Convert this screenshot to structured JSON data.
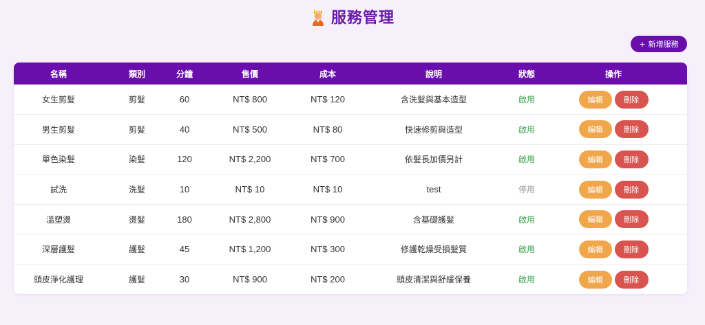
{
  "header": {
    "title": "服務管理",
    "logo_icon": "barber-person-icon"
  },
  "toolbar": {
    "add_label": "新增服務"
  },
  "colors": {
    "accent": "#6a0dad",
    "edit": "#f0a64a",
    "delete": "#d9534f",
    "active": "#3aa14a",
    "inactive": "#9a9a9a"
  },
  "table": {
    "columns": [
      "名稱",
      "類別",
      "分鐘",
      "售價",
      "成本",
      "說明",
      "狀態",
      "操作"
    ],
    "rows": [
      {
        "name": "女生剪髮",
        "category": "剪髮",
        "minutes": "60",
        "price": "NT$ 800",
        "cost": "NT$ 120",
        "desc": "含洗髮與基本造型",
        "status": "啟用",
        "active": true
      },
      {
        "name": "男生剪髮",
        "category": "剪髮",
        "minutes": "40",
        "price": "NT$ 500",
        "cost": "NT$ 80",
        "desc": "快速修剪與造型",
        "status": "啟用",
        "active": true
      },
      {
        "name": "單色染髮",
        "category": "染髮",
        "minutes": "120",
        "price": "NT$ 2,200",
        "cost": "NT$ 700",
        "desc": "依髮長加價另計",
        "status": "啟用",
        "active": true
      },
      {
        "name": "試洗",
        "category": "洗髮",
        "minutes": "10",
        "price": "NT$ 10",
        "cost": "NT$ 10",
        "desc": "test",
        "status": "停用",
        "active": false
      },
      {
        "name": "溫塑燙",
        "category": "燙髮",
        "minutes": "180",
        "price": "NT$ 2,800",
        "cost": "NT$ 900",
        "desc": "含基礎護髮",
        "status": "啟用",
        "active": true
      },
      {
        "name": "深層護髮",
        "category": "護髮",
        "minutes": "45",
        "price": "NT$ 1,200",
        "cost": "NT$ 300",
        "desc": "修護乾燥受損髮質",
        "status": "啟用",
        "active": true
      },
      {
        "name": "頭皮淨化護理",
        "category": "護髮",
        "minutes": "30",
        "price": "NT$ 900",
        "cost": "NT$ 200",
        "desc": "頭皮清潔與舒緩保養",
        "status": "啟用",
        "active": true
      }
    ],
    "edit_label": "編輯",
    "delete_label": "刪除"
  }
}
